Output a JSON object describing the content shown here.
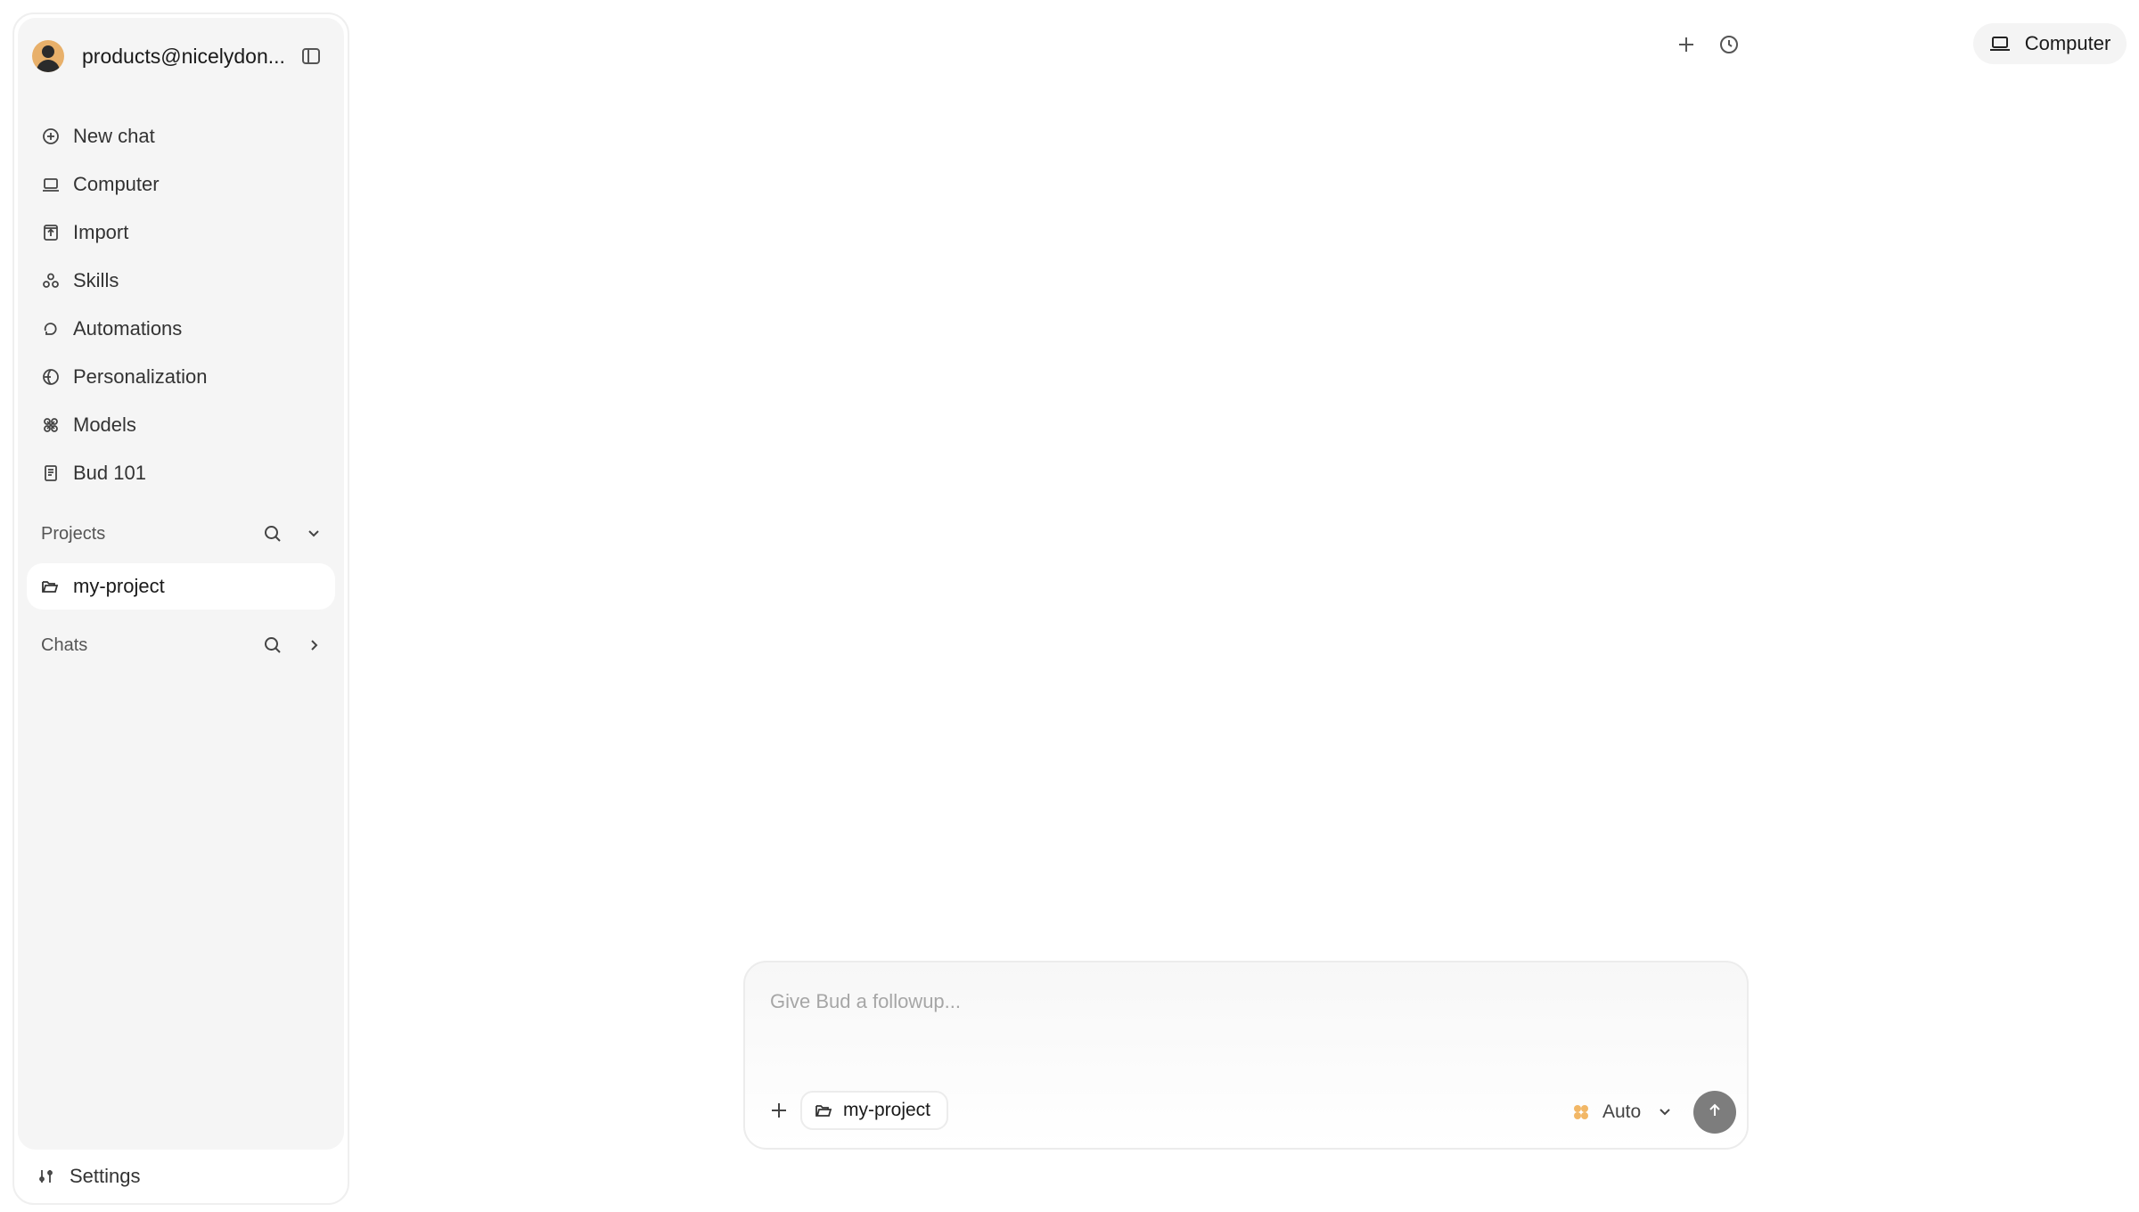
{
  "sidebar": {
    "user_email": "products@nicelydon...",
    "nav": [
      {
        "label": "New chat",
        "icon": "plus-circle-icon"
      },
      {
        "label": "Computer",
        "icon": "laptop-icon"
      },
      {
        "label": "Import",
        "icon": "import-icon"
      },
      {
        "label": "Skills",
        "icon": "skills-icon"
      },
      {
        "label": "Automations",
        "icon": "automations-icon"
      },
      {
        "label": "Personalization",
        "icon": "personalization-icon"
      },
      {
        "label": "Models",
        "icon": "models-icon"
      },
      {
        "label": "Bud 101",
        "icon": "book-icon"
      }
    ],
    "projects_label": "Projects",
    "projects": [
      {
        "label": "my-project",
        "icon": "folder-icon"
      }
    ],
    "chats_label": "Chats",
    "settings_label": "Settings"
  },
  "header": {
    "computer_label": "Computer"
  },
  "composer": {
    "placeholder": "Give Bud a followup...",
    "project_chip": "my-project",
    "model_label": "Auto"
  },
  "colors": {
    "accent_model_dot": "#f2b766",
    "send_button": "#7d7d7d",
    "sidebar_bg": "#f5f5f5"
  }
}
